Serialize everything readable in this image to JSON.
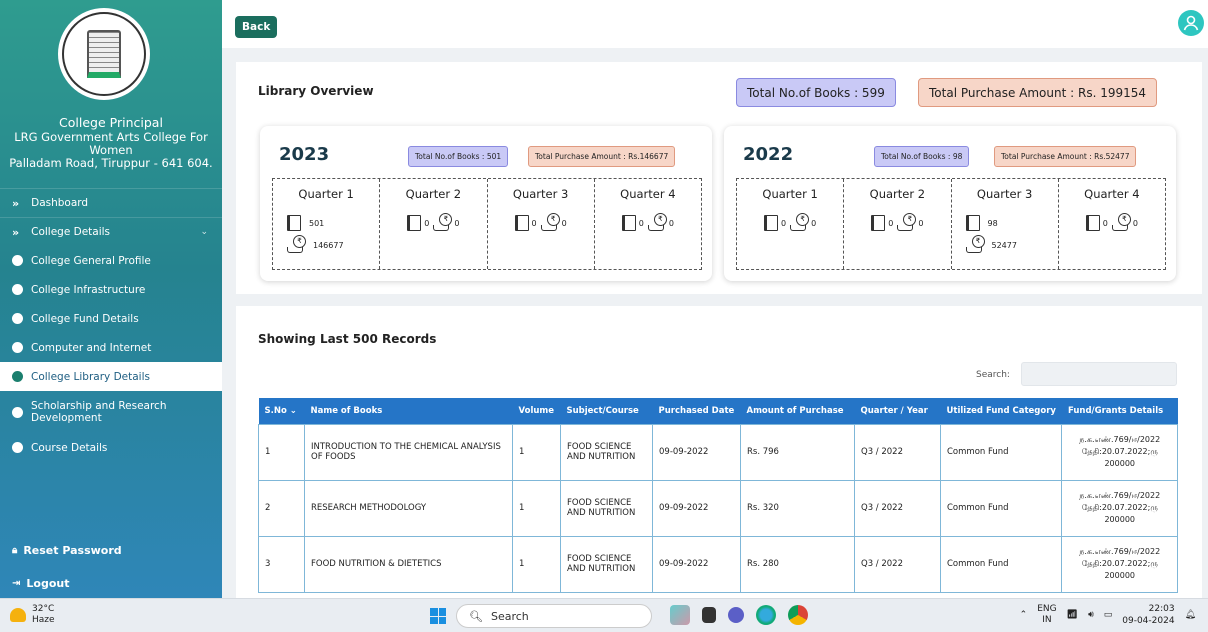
{
  "sidebar": {
    "title": "College Principal",
    "college_line1": "LRG Government Arts College For",
    "college_line2": "Women",
    "college_line3": "Palladam Road, Tiruppur - 641 604.",
    "nav": [
      {
        "label": "Dashboard"
      },
      {
        "label": "College Details"
      },
      {
        "label": "College General Profile"
      },
      {
        "label": "College Infrastructure"
      },
      {
        "label": "College Fund Details"
      },
      {
        "label": "Computer and Internet"
      },
      {
        "label": "College Library Details"
      },
      {
        "label": "Scholarship and Research Development"
      },
      {
        "label": "Course Details"
      }
    ],
    "reset_password": "Reset Password",
    "logout": "Logout"
  },
  "topbar": {
    "back_label": "Back"
  },
  "overview": {
    "title": "Library Overview",
    "total_books": "Total No.of Books : 599",
    "total_amount": "Total Purchase Amount : Rs. 199154",
    "years": [
      {
        "year": "2023",
        "books_pill": "Total No.of Books : 501",
        "amount_pill": "Total Purchase Amount : Rs.146677",
        "quarters": [
          {
            "name": "Quarter 1",
            "books": "501",
            "amount": "146677"
          },
          {
            "name": "Quarter 2",
            "books": "0",
            "amount": "0"
          },
          {
            "name": "Quarter 3",
            "books": "0",
            "amount": "0"
          },
          {
            "name": "Quarter 4",
            "books": "0",
            "amount": "0"
          }
        ]
      },
      {
        "year": "2022",
        "books_pill": "Total No.of Books : 98",
        "amount_pill": "Total Purchase Amount : Rs.52477",
        "quarters": [
          {
            "name": "Quarter 1",
            "books": "0",
            "amount": "0"
          },
          {
            "name": "Quarter 2",
            "books": "0",
            "amount": "0"
          },
          {
            "name": "Quarter 3",
            "books": "98",
            "amount": "52477"
          },
          {
            "name": "Quarter 4",
            "books": "0",
            "amount": "0"
          }
        ]
      }
    ]
  },
  "records": {
    "title": "Showing Last 500 Records",
    "search_label": "Search:",
    "columns": [
      "S.No",
      "Name of Books",
      "Volume",
      "Subject/Course",
      "Purchased Date",
      "Amount of Purchase",
      "Quarter / Year",
      "Utilized Fund Category",
      "Fund/Grants Details"
    ],
    "rows": [
      {
        "sno": "1",
        "name": "INTRODUCTION TO THE CHEMICAL ANALYSIS OF FOODS",
        "volume": "1",
        "subject": "FOOD SCIENCE AND NUTRITION",
        "date": "09-09-2022",
        "amount": "Rs. 796",
        "quarter": "Q3 / 2022",
        "fund": "Common Fund",
        "grant": "ந.க.எண்.769/ஈ/2022 தேதி:20.07.2022;ரு 200000"
      },
      {
        "sno": "2",
        "name": "RESEARCH METHODOLOGY",
        "volume": "1",
        "subject": "FOOD SCIENCE AND NUTRITION",
        "date": "09-09-2022",
        "amount": "Rs. 320",
        "quarter": "Q3 / 2022",
        "fund": "Common Fund",
        "grant": "ந.க.எண்.769/ஈ/2022 தேதி:20.07.2022;ரு 200000"
      },
      {
        "sno": "3",
        "name": "FOOD NUTRITION & DIETETICS",
        "volume": "1",
        "subject": "FOOD SCIENCE AND NUTRITION",
        "date": "09-09-2022",
        "amount": "Rs. 280",
        "quarter": "Q3 / 2022",
        "fund": "Common Fund",
        "grant": "ந.க.எண்.769/ஈ/2022 தேதி:20.07.2022;ரு 200000"
      }
    ]
  },
  "taskbar": {
    "temp": "32°C",
    "weather": "Haze",
    "search": "Search",
    "lang1": "ENG",
    "lang2": "IN",
    "time": "22:03",
    "date": "09-04-2024"
  },
  "colors": {
    "table_header": "#2575c7",
    "sidebar_top": "#2f9c8f",
    "back_button": "#1b6e5e"
  }
}
